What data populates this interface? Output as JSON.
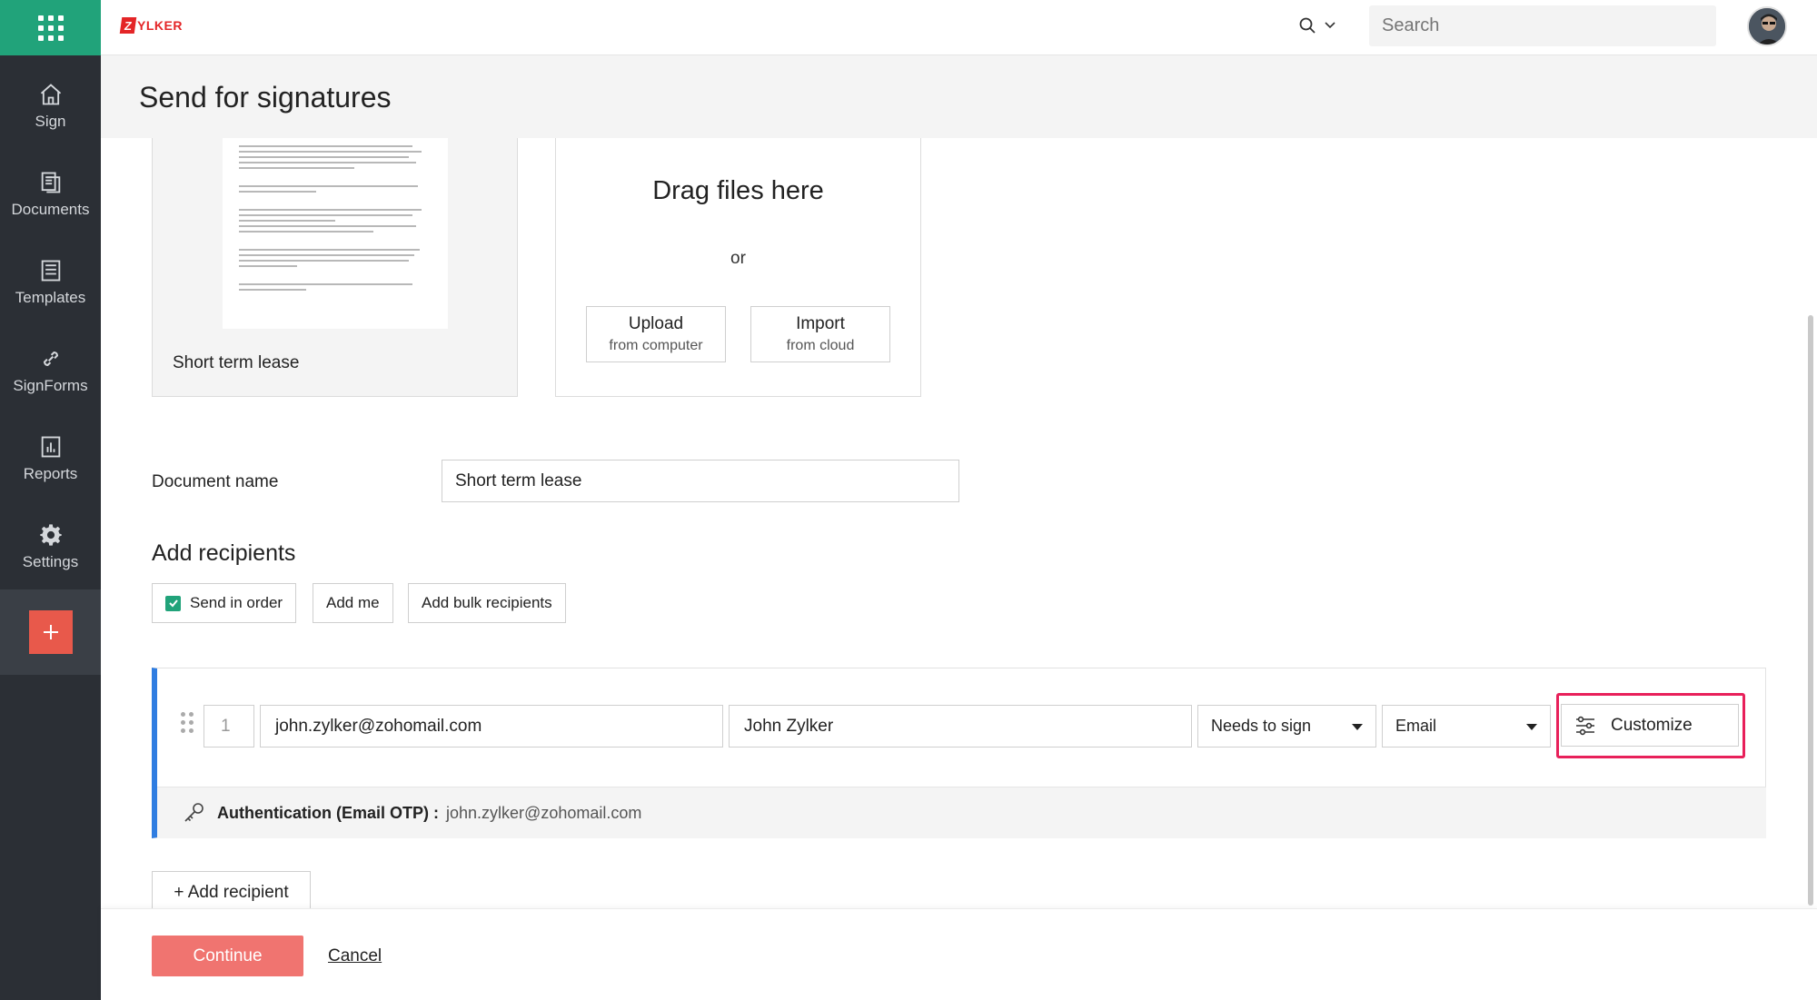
{
  "app": {
    "brand_first": "Z",
    "brand_rest": "YLKER"
  },
  "sidebar": {
    "items": [
      {
        "label": "Sign",
        "icon": "home-icon"
      },
      {
        "label": "Documents",
        "icon": "documents-icon"
      },
      {
        "label": "Templates",
        "icon": "templates-icon"
      },
      {
        "label": "SignForms",
        "icon": "link-icon"
      },
      {
        "label": "Reports",
        "icon": "reports-icon"
      },
      {
        "label": "Settings",
        "icon": "gear-icon"
      }
    ]
  },
  "search": {
    "placeholder": "Search"
  },
  "page": {
    "title": "Send for signatures"
  },
  "document": {
    "name": "Short term lease"
  },
  "dropzone": {
    "title": "Drag files here",
    "or": "or",
    "upload_main": "Upload",
    "upload_sub": "from computer",
    "import_main": "Import",
    "import_sub": "from cloud"
  },
  "form": {
    "document_name_label": "Document name",
    "document_name_value": "Short term lease"
  },
  "recipients": {
    "title": "Add recipients",
    "send_in_order_label": "Send in order",
    "send_in_order_checked": true,
    "add_me_label": "Add me",
    "add_bulk_label": "Add bulk recipients",
    "list": [
      {
        "order": "1",
        "email": "john.zylker@zohomail.com",
        "name": "John Zylker",
        "action": "Needs to sign",
        "delivery": "Email",
        "customize_label": "Customize",
        "auth_label": "Authentication (Email OTP) :",
        "auth_value": "john.zylker@zohomail.com"
      }
    ],
    "add_recipient_label": "+ Add recipient"
  },
  "footer": {
    "continue_label": "Continue",
    "cancel_label": "Cancel"
  },
  "colors": {
    "sidebar_bg": "#2b2f35",
    "accent_green": "#21a37a",
    "brand_red": "#e42527",
    "recipient_bar": "#2f7de1",
    "highlight": "#e8205a",
    "continue": "#f07470"
  }
}
